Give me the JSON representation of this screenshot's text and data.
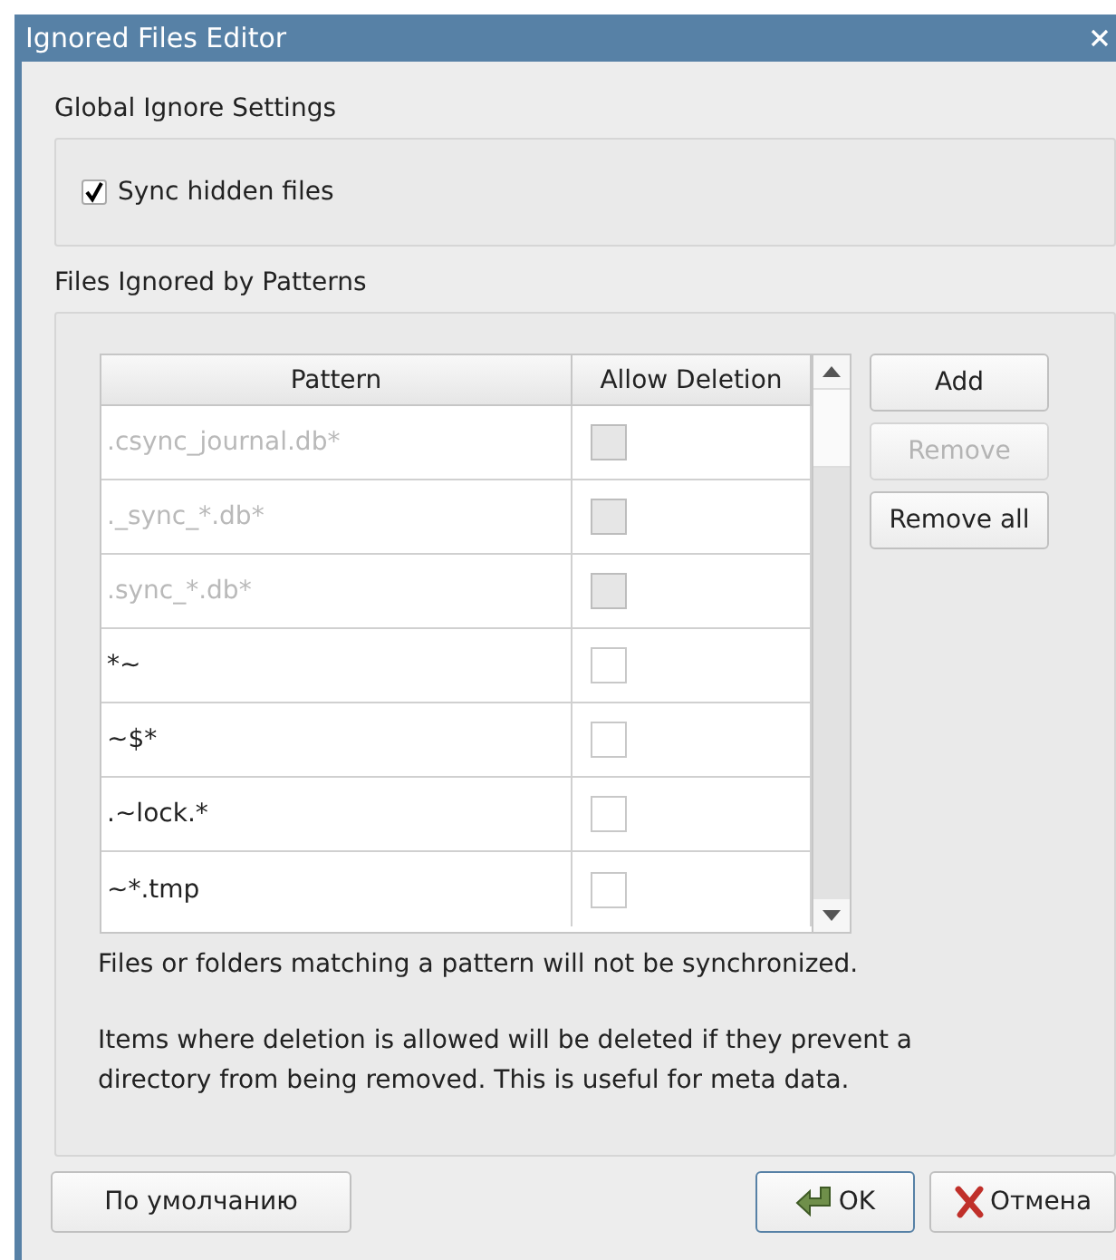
{
  "window": {
    "title": "Ignored Files Editor"
  },
  "global_settings": {
    "title": "Global Ignore Settings",
    "sync_hidden": {
      "label": "Sync hidden files",
      "checked": true
    }
  },
  "patterns": {
    "title": "Files Ignored by Patterns",
    "columns": [
      "Pattern",
      "Allow Deletion"
    ],
    "rows": [
      {
        "pattern": ".csync_journal.db*",
        "allow_deletion": false,
        "disabled": true
      },
      {
        "pattern": "._sync_*.db*",
        "allow_deletion": false,
        "disabled": true
      },
      {
        "pattern": ".sync_*.db*",
        "allow_deletion": false,
        "disabled": true
      },
      {
        "pattern": "*~",
        "allow_deletion": false,
        "disabled": false
      },
      {
        "pattern": "~$*",
        "allow_deletion": false,
        "disabled": false
      },
      {
        "pattern": ".~lock.*",
        "allow_deletion": false,
        "disabled": false
      },
      {
        "pattern": "~*.tmp",
        "allow_deletion": false,
        "disabled": false
      }
    ],
    "buttons": [
      {
        "label": "Add",
        "disabled": false
      },
      {
        "label": "Remove",
        "disabled": true
      },
      {
        "label": "Remove all",
        "disabled": false
      }
    ],
    "notes": [
      "Files or folders matching a pattern will not be synchronized.",
      "Items where deletion is allowed will be deleted if they prevent a directory from being removed. This is useful for meta data."
    ]
  },
  "footer": {
    "defaults_button": "По умолчанию",
    "ok_button": "OK",
    "cancel_button": "Отмена"
  }
}
